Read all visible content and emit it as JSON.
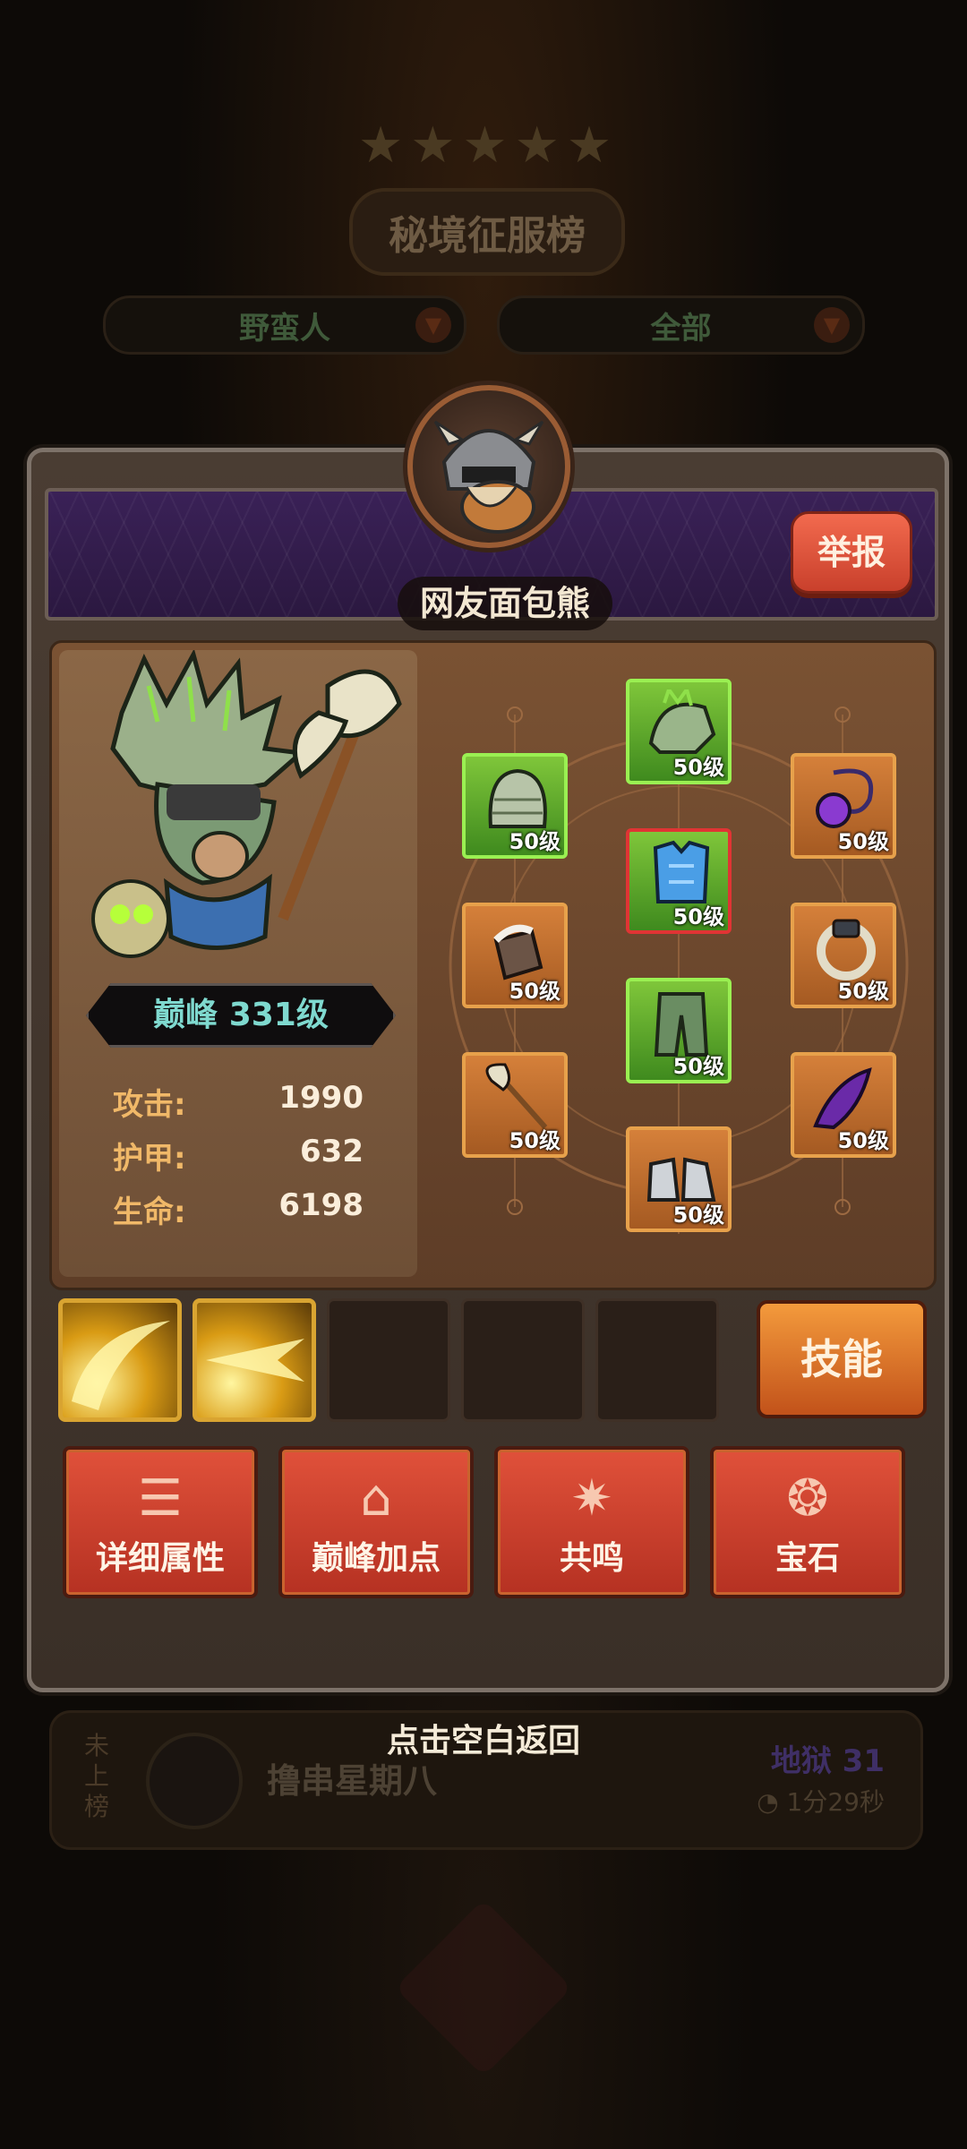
{
  "background": {
    "title": "秘境征服榜",
    "filters": [
      "野蛮人",
      "全部"
    ],
    "row": {
      "rank": "未上榜",
      "name": "撸串星期八",
      "level": "地狱 31",
      "time": "1分29秒"
    }
  },
  "dialog": {
    "player_name": "网友面包熊",
    "report_label": "举报",
    "rank_label": "巅峰 331级",
    "stats": [
      {
        "label": "攻击:",
        "value": "1990"
      },
      {
        "label": "护甲:",
        "value": "632"
      },
      {
        "label": "生命:",
        "value": "6198"
      }
    ],
    "equipment": [
      {
        "name": "helmet",
        "level": "50级",
        "color": "green"
      },
      {
        "name": "shoulder",
        "level": "50级",
        "color": "green"
      },
      {
        "name": "amulet",
        "level": "50级",
        "color": "orange"
      },
      {
        "name": "chest",
        "level": "50级",
        "color": "green",
        "selected": true
      },
      {
        "name": "gloves",
        "level": "50级",
        "color": "orange"
      },
      {
        "name": "ring",
        "level": "50级",
        "color": "orange"
      },
      {
        "name": "pants",
        "level": "50级",
        "color": "green"
      },
      {
        "name": "weapon-axe",
        "level": "50级",
        "color": "orange"
      },
      {
        "name": "horn",
        "level": "50级",
        "color": "orange"
      },
      {
        "name": "boots",
        "level": "50级",
        "color": "orange"
      }
    ],
    "skills_label": "技能",
    "actions": [
      {
        "label": "详细属性",
        "icon": "list-icon"
      },
      {
        "label": "巅峰加点",
        "icon": "house-plus-icon"
      },
      {
        "label": "共鸣",
        "icon": "star-burst-icon"
      },
      {
        "label": "宝石",
        "icon": "gem-ring-icon"
      }
    ]
  },
  "hint": "点击空白返回"
}
